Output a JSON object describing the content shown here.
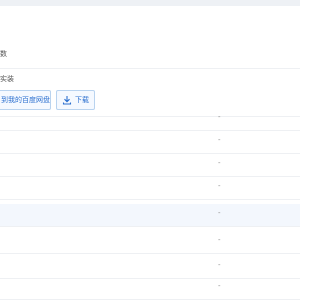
{
  "header": {
    "line1_text": "数",
    "line2_text": "实装"
  },
  "toolbar": {
    "save_label": "到我的百度网盘",
    "download_label": "下载"
  },
  "rows": [
    {
      "size": "-"
    },
    {
      "size": "-"
    },
    {
      "size": "-"
    },
    {
      "size": "-"
    },
    {
      "size": "-"
    },
    {
      "size": "-"
    },
    {
      "size": "-"
    },
    {
      "size": "-"
    }
  ],
  "colors": {
    "accent": "#2b6fcf",
    "selected_row": "#f3f7fd"
  },
  "icons": {
    "download": "download-icon"
  }
}
